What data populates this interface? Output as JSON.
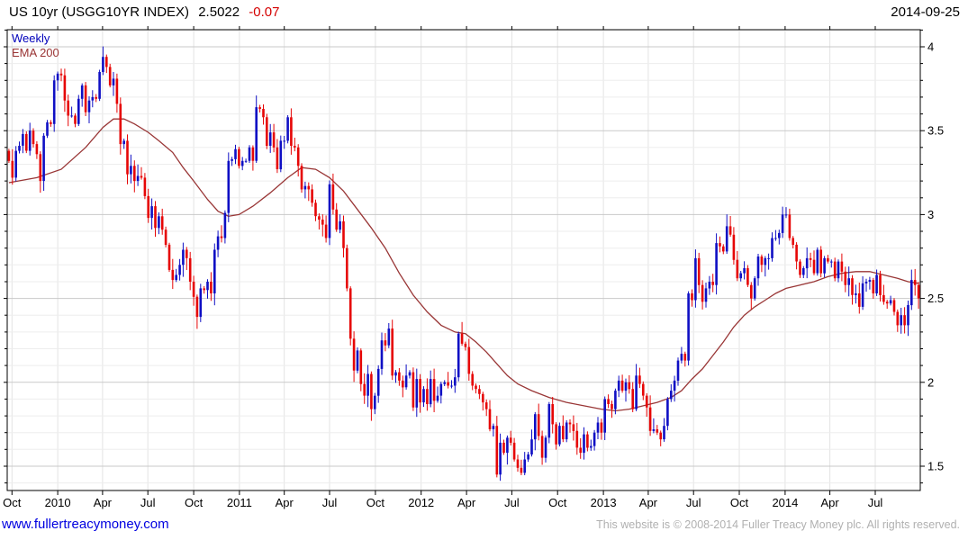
{
  "header": {
    "title": "US 10yr (USGG10YR INDEX)",
    "value": "2.5022",
    "change": "-0.07",
    "date": "2014-09-25"
  },
  "legend": {
    "weekly": "Weekly",
    "ema": "EMA 200"
  },
  "footer": {
    "link": "www.fullertreacymoney.com",
    "copyright": "This website is © 2008-2014 Fuller Treacy Money plc. All rights reserved."
  },
  "colors": {
    "up": "#0f0fc4",
    "down": "#e60606",
    "ema": "#993636",
    "grid_minor": "#ededed",
    "grid_major": "#c9c9c9",
    "grid_vert": "#e3e3e3",
    "axis": "#000000"
  },
  "chart_data": {
    "type": "candlestick",
    "title": "US 10yr (USGG10YR INDEX) weekly yield with 200 EMA",
    "interval": "weekly",
    "x_range": [
      "2009-09-25",
      "2014-09-25"
    ],
    "ylim": [
      1.355,
      4.102
    ],
    "grid": "on",
    "legend_position": "top-left",
    "y_ticks": [
      {
        "v": 1.5,
        "label": "1.5"
      },
      {
        "v": 2.0,
        "label": "2"
      },
      {
        "v": 2.5,
        "label": "2.5"
      },
      {
        "v": 3.0,
        "label": "3"
      },
      {
        "v": 3.5,
        "label": "3.5"
      },
      {
        "v": 4.0,
        "label": "4"
      }
    ],
    "x_ticks": [
      {
        "week": 0.86,
        "label": "Oct"
      },
      {
        "week": 14.0,
        "label": "2010"
      },
      {
        "week": 26.86,
        "label": "Apr"
      },
      {
        "week": 39.86,
        "label": "Jul"
      },
      {
        "week": 53.0,
        "label": "Oct"
      },
      {
        "week": 66.14,
        "label": "2011"
      },
      {
        "week": 79.0,
        "label": "Apr"
      },
      {
        "week": 92.0,
        "label": "Jul"
      },
      {
        "week": 105.14,
        "label": "Oct"
      },
      {
        "week": 118.29,
        "label": "2012"
      },
      {
        "week": 131.29,
        "label": "Apr"
      },
      {
        "week": 144.29,
        "label": "Jul"
      },
      {
        "week": 157.43,
        "label": "Oct"
      },
      {
        "week": 170.57,
        "label": "2013"
      },
      {
        "week": 183.43,
        "label": "Apr"
      },
      {
        "week": 196.43,
        "label": "Jul"
      },
      {
        "week": 209.57,
        "label": "Oct"
      },
      {
        "week": 222.71,
        "label": "2014"
      },
      {
        "week": 235.57,
        "label": "Apr"
      },
      {
        "week": 248.57,
        "label": "Jul"
      }
    ],
    "first_open": 3.38,
    "weekly_close": [
      3.32,
      3.22,
      3.38,
      3.41,
      3.48,
      3.38,
      3.5,
      3.42,
      3.36,
      3.2,
      3.47,
      3.55,
      3.54,
      3.8,
      3.84,
      3.83,
      3.68,
      3.59,
      3.59,
      3.54,
      3.69,
      3.77,
      3.61,
      3.68,
      3.7,
      3.69,
      3.85,
      3.94,
      3.88,
      3.77,
      3.81,
      3.66,
      3.42,
      3.44,
      3.24,
      3.29,
      3.2,
      3.23,
      3.22,
      3.11,
      2.98,
      3.05,
      2.92,
      2.99,
      2.91,
      2.82,
      2.67,
      2.61,
      2.64,
      2.7,
      2.79,
      2.74,
      2.6,
      2.51,
      2.39,
      2.56,
      2.55,
      2.6,
      2.53,
      2.79,
      2.87,
      2.86,
      3.01,
      3.32,
      3.33,
      3.39,
      3.29,
      3.32,
      3.32,
      3.4,
      3.32,
      3.64,
      3.63,
      3.58,
      3.41,
      3.49,
      3.4,
      3.27,
      3.44,
      3.44,
      3.58,
      3.41,
      3.4,
      3.29,
      3.15,
      3.17,
      3.15,
      3.07,
      2.99,
      2.97,
      2.94,
      2.86,
      3.18,
      3.03,
      2.91,
      2.96,
      2.8,
      2.56,
      2.26,
      2.07,
      2.19,
      1.99,
      1.92,
      2.05,
      1.84,
      1.92,
      2.08,
      2.25,
      2.22,
      2.32,
      2.04,
      2.06,
      2.01,
      1.97,
      2.04,
      2.06,
      1.85,
      2.02,
      1.88,
      1.96,
      1.87,
      2.02,
      1.89,
      1.92,
      1.99,
      2.0,
      1.98,
      1.98,
      2.03,
      2.29,
      2.23,
      2.21,
      2.05,
      1.98,
      1.96,
      1.93,
      1.88,
      1.84,
      1.72,
      1.74,
      1.45,
      1.64,
      1.58,
      1.67,
      1.64,
      1.54,
      1.49,
      1.46,
      1.54,
      1.57,
      1.66,
      1.81,
      1.68,
      1.55,
      1.67,
      1.87,
      1.75,
      1.63,
      1.74,
      1.66,
      1.76,
      1.75,
      1.71,
      1.61,
      1.58,
      1.69,
      1.61,
      1.62,
      1.7,
      1.76,
      1.7,
      1.9,
      1.87,
      1.84,
      1.95,
      2.01,
      1.95,
      2.0,
      1.96,
      1.84,
      2.04,
      1.99,
      1.92,
      1.85,
      1.71,
      1.72,
      1.7,
      1.66,
      1.74,
      1.9,
      1.95,
      2.01,
      2.13,
      2.17,
      2.13,
      2.53,
      2.49,
      2.74,
      2.58,
      2.48,
      2.56,
      2.6,
      2.58,
      2.83,
      2.81,
      2.78,
      2.93,
      2.88,
      2.73,
      2.62,
      2.65,
      2.68,
      2.58,
      2.5,
      2.62,
      2.75,
      2.7,
      2.74,
      2.74,
      2.86,
      2.86,
      2.89,
      3.0,
      3.0,
      2.86,
      2.82,
      2.72,
      2.64,
      2.68,
      2.74,
      2.73,
      2.65,
      2.79,
      2.65,
      2.74,
      2.72,
      2.72,
      2.62,
      2.72,
      2.66,
      2.58,
      2.62,
      2.52,
      2.53,
      2.45,
      2.59,
      2.6,
      2.61,
      2.53,
      2.64,
      2.52,
      2.48,
      2.47,
      2.49,
      2.42,
      2.34,
      2.4,
      2.34,
      2.46,
      2.61,
      2.58,
      2.5
    ],
    "ema200_anchors": [
      [
        0,
        3.19
      ],
      [
        8,
        3.22
      ],
      [
        15,
        3.27
      ],
      [
        22,
        3.4
      ],
      [
        27,
        3.52
      ],
      [
        30,
        3.57
      ],
      [
        33,
        3.57
      ],
      [
        36,
        3.54
      ],
      [
        40,
        3.49
      ],
      [
        43,
        3.44
      ],
      [
        47,
        3.37
      ],
      [
        50,
        3.28
      ],
      [
        53,
        3.2
      ],
      [
        57,
        3.09
      ],
      [
        60,
        3.02
      ],
      [
        63,
        2.99
      ],
      [
        66,
        3.0
      ],
      [
        70,
        3.05
      ],
      [
        75,
        3.13
      ],
      [
        80,
        3.22
      ],
      [
        84,
        3.28
      ],
      [
        88,
        3.27
      ],
      [
        92,
        3.22
      ],
      [
        96,
        3.14
      ],
      [
        100,
        3.03
      ],
      [
        104,
        2.92
      ],
      [
        108,
        2.8
      ],
      [
        112,
        2.65
      ],
      [
        116,
        2.52
      ],
      [
        120,
        2.42
      ],
      [
        124,
        2.34
      ],
      [
        128,
        2.3
      ],
      [
        131,
        2.29
      ],
      [
        134,
        2.24
      ],
      [
        137,
        2.18
      ],
      [
        140,
        2.11
      ],
      [
        143,
        2.04
      ],
      [
        146,
        1.99
      ],
      [
        150,
        1.95
      ],
      [
        155,
        1.91
      ],
      [
        160,
        1.88
      ],
      [
        165,
        1.86
      ],
      [
        170,
        1.84
      ],
      [
        174,
        1.83
      ],
      [
        178,
        1.84
      ],
      [
        182,
        1.86
      ],
      [
        186,
        1.88
      ],
      [
        190,
        1.91
      ],
      [
        193,
        1.95
      ],
      [
        196,
        2.02
      ],
      [
        199,
        2.08
      ],
      [
        202,
        2.16
      ],
      [
        205,
        2.24
      ],
      [
        208,
        2.33
      ],
      [
        211,
        2.4
      ],
      [
        214,
        2.45
      ],
      [
        217,
        2.49
      ],
      [
        220,
        2.53
      ],
      [
        223,
        2.56
      ],
      [
        227,
        2.58
      ],
      [
        231,
        2.6
      ],
      [
        235,
        2.63
      ],
      [
        239,
        2.65
      ],
      [
        243,
        2.66
      ],
      [
        247,
        2.66
      ],
      [
        251,
        2.64
      ],
      [
        255,
        2.62
      ],
      [
        258,
        2.6
      ],
      [
        261,
        2.59
      ]
    ]
  }
}
